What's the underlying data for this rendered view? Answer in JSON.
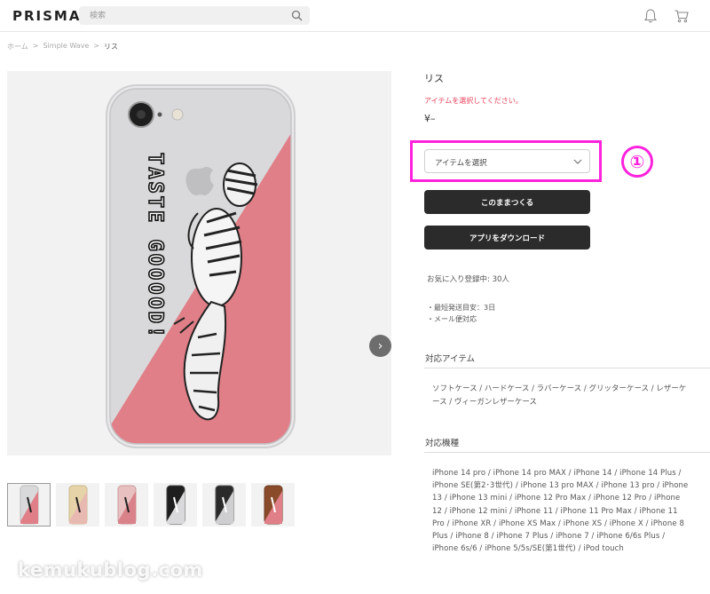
{
  "header": {
    "logo": "PRISMA",
    "search_placeholder": "検索"
  },
  "breadcrumb": {
    "items": [
      "ホーム",
      ">",
      "Simple Wave",
      ">",
      "リス"
    ]
  },
  "product": {
    "name": "リス",
    "select_message": "アイテムを選択してください。",
    "price": "¥–",
    "select_label": "アイテムを選択",
    "make_button": "このままつくる",
    "app_button": "アプリをダウンロード",
    "favorites": "お気に入り登録中: 30人",
    "shipping_lines": [
      "・最短発送目安：3日",
      "・メール便対応"
    ],
    "image_text": "TASTE GOOOOD!"
  },
  "annotation": {
    "step_number": "①",
    "color": "#ff22dd"
  },
  "compatible_items": {
    "title": "対応アイテム",
    "text": "ソフトケース / ハードケース / ラバーケース / グリッターケース / レザーケース / ヴィーガンレザーケース"
  },
  "compatible_models": {
    "title": "対応機種",
    "text": "iPhone 14 pro / iPhone 14 pro MAX / iPhone 14 / iPhone 14 Plus / iPhone SE(第2･3世代) / iPhone 13 pro MAX / iPhone 13 pro / iPhone 13 / iPhone 13 mini / iPhone 12 Pro Max / iPhone 12 Pro / iPhone 12 / iPhone 12 mini / iPhone 11 / iPhone 11 Pro Max / iPhone 11 Pro / iPhone XR / iPhone XS Max / iPhone XS / iPhone X / iPhone 8 Plus / iPhone 8 / iPhone 7 Plus / iPhone 7 / iPhone 6/6s Plus / iPhone 6s/6 / iPhone 5/5s/SE(第1世代) / iPod touch"
  },
  "watermark": "kemukublog.com",
  "colors": {
    "accent_pink": "#e8405b",
    "case_pink": "#e07f87",
    "button_dark": "#2b2b2b"
  },
  "thumbnails": [
    {
      "variant": "clear-pink",
      "active": true
    },
    {
      "variant": "gold"
    },
    {
      "variant": "rose"
    },
    {
      "variant": "black-clear"
    },
    {
      "variant": "black-clear-2"
    },
    {
      "variant": "brown-leather"
    }
  ]
}
